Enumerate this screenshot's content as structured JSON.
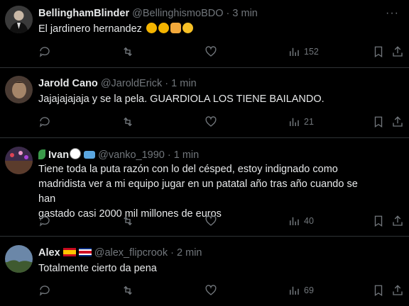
{
  "tweets": [
    {
      "name": "BellinghamBlinder",
      "handle": "@BellinghismoBDO",
      "dot": "·",
      "time": "3 min",
      "text": "El jardinero hernandez",
      "emojis": [
        "rolling-on-floor-laughing",
        "rolling-on-floor-laughing",
        "clapping-hands",
        "tears-of-joy"
      ],
      "views": "152",
      "avatar": "avatar-dark-suit"
    },
    {
      "name": "Jarold Cano",
      "handle": "@JaroldErick",
      "dot": "·",
      "time": "1 min",
      "text": "Jajajajajaja y se la pela. GUARDIOLA LOS TIENE BAILANDO.",
      "views": "21",
      "avatar": "avatar-man-face"
    },
    {
      "name": "Ivan",
      "name_emojis": [
        "plant-icon",
        "soccer-ball",
        "stadium-icon"
      ],
      "handle": "@vanko_1990",
      "dot": "·",
      "time": "1 min",
      "text_lines": [
        "Tiene toda la puta razón con lo del césped, estoy indignado como",
        "madridista ver a mi equipo jugar en un patatal año tras año cuando se han",
        "gastado casi 2000 mil millones de euros"
      ],
      "views": "40",
      "avatar": "avatar-stadium-crowd"
    },
    {
      "name": "Alex",
      "name_emojis": [
        "spain-flag",
        "costa-rica-flag"
      ],
      "handle": "@alex_flipcrook",
      "dot": "·",
      "time": "2 min",
      "text": "Totalmente cierto da pena",
      "views": "69",
      "avatar": "avatar-landscape"
    }
  ],
  "more_label": "···"
}
